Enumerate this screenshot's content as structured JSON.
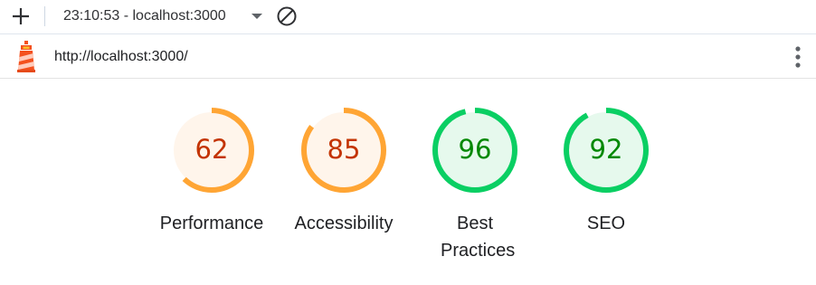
{
  "toolbar": {
    "report_label": "23:10:53 - localhost:3000",
    "add_icon": "plus-icon",
    "dropdown_icon": "caret-down-icon",
    "clear_icon": "block-icon"
  },
  "urlbar": {
    "logo_icon": "lighthouse-icon",
    "url": "http://localhost:3000/",
    "menu_icon": "more-vertical-icon"
  },
  "gauges": [
    {
      "label": "Performance",
      "score": "62",
      "value": 0.62,
      "status": "average"
    },
    {
      "label": "Accessibility",
      "score": "85",
      "value": 0.85,
      "status": "average"
    },
    {
      "label": "Best Practices",
      "score": "96",
      "value": 0.96,
      "status": "pass"
    },
    {
      "label": "SEO",
      "score": "92",
      "value": 0.92,
      "status": "pass"
    }
  ],
  "colors": {
    "average_stroke": "#ffa534",
    "average_fill": "#fff5eb",
    "average_text": "#c33300",
    "pass_stroke": "#0acf63",
    "pass_fill": "#e6f9ed",
    "pass_text": "#008800",
    "track": "#ededed"
  }
}
